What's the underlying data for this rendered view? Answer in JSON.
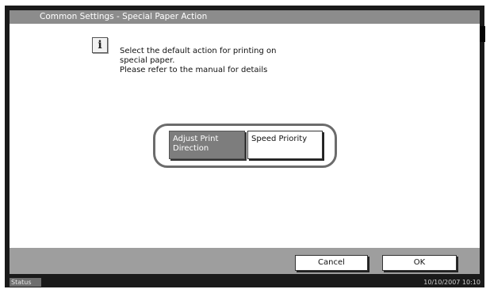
{
  "title_bar": {
    "title": "Common Settings - Special Paper Action"
  },
  "message": {
    "icon": "info-icon",
    "icon_glyph": "i",
    "lines": [
      "Select the default action for printing on",
      "special paper.",
      "Please refer to the manual for details"
    ]
  },
  "options": [
    {
      "label_lines": [
        "Adjust Print",
        "Direction"
      ],
      "selected": true
    },
    {
      "label_lines": [
        "Speed Priority"
      ],
      "selected": false
    }
  ],
  "actions": {
    "cancel": "Cancel",
    "ok": "OK"
  },
  "status_bar": {
    "status": "Status",
    "datetime": "10/10/2007  10:10"
  },
  "colors": {
    "selected_option": "#7d7d7d",
    "title_bar": "#8c8c8c",
    "bottom_bar": "#9e9e9e"
  }
}
